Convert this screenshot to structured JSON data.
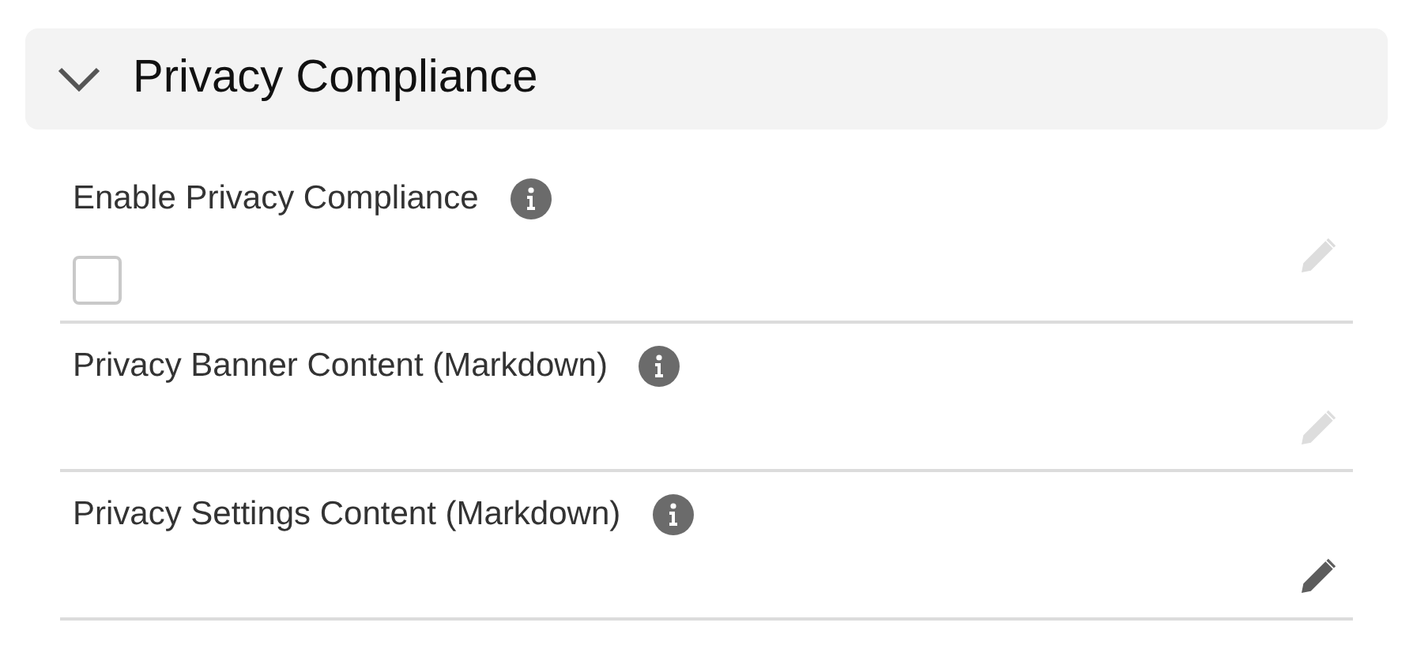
{
  "section": {
    "title": "Privacy Compliance",
    "expanded": true
  },
  "fields": [
    {
      "kind": "checkbox",
      "label": "Enable Privacy Compliance",
      "checked": false,
      "hovered": false
    },
    {
      "kind": "text",
      "label": "Privacy Banner Content (Markdown)",
      "hovered": false
    },
    {
      "kind": "text",
      "label": "Privacy Settings Content (Markdown)",
      "hovered": true
    }
  ]
}
